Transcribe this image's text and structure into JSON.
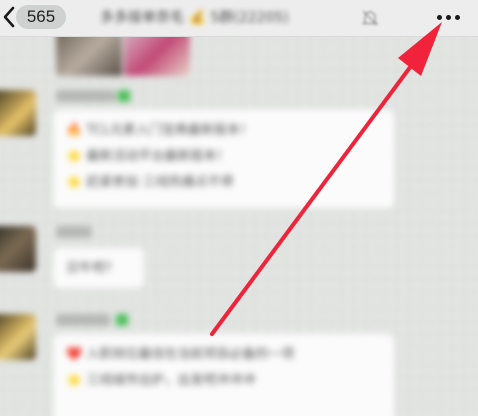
{
  "header": {
    "unread_count": "565",
    "chat_title": "多多接单奈毛 💰 5群(22205)",
    "icons": {
      "back": "chevron-left-icon",
      "mute": "bell-off-icon",
      "more": "more-dots-icon"
    }
  },
  "messages": {
    "bubble1_lines": [
      "🔥 TCL元素入门宝典最新版本！",
      "⭐ 最新活动平台最新版本！",
      "⭐ 赶紧参加 三线热爆点不停"
    ],
    "bubble2_text": "日牛吧?",
    "bubble3_lines": [
      "❤️ 入职岗位最佳在当前项目必备的一项",
      "⭐ 三线城市出炉，出发吧冲冲冲"
    ]
  },
  "colors": {
    "arrow": "#f0233a",
    "online_tag": "#4cc05a",
    "nav_bg": "#ededed"
  }
}
